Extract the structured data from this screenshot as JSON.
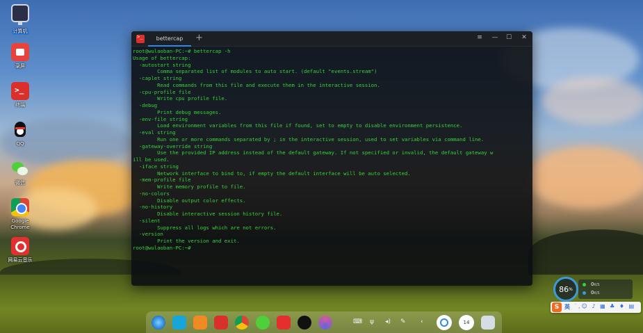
{
  "desktop": {
    "icons": [
      {
        "label": "计算机"
      },
      {
        "label": "录屏"
      },
      {
        "label": "终端"
      },
      {
        "label": "QQ"
      },
      {
        "label": "微信"
      },
      {
        "label": "Google Chrome"
      },
      {
        "label": "网易云音乐"
      }
    ]
  },
  "terminal": {
    "tab_title": "bettercap",
    "new_tab_glyph": "+",
    "menu_glyph": "≡",
    "minimize_glyph": "—",
    "maximize_glyph": "☐",
    "close_glyph": "✕",
    "lines": [
      "root@wulaoban-PC:~# bettercap -h",
      "Usage of bettercap:",
      "  -autostart string",
      "        Comma separated list of modules to auto start. (default \"events.stream\")",
      "  -caplet string",
      "        Read commands from this file and execute them in the interactive session.",
      "  -cpu-profile file",
      "        Write cpu profile file.",
      "  -debug",
      "        Print debug messages.",
      "  -env-file string",
      "        Load environment variables from this file if found, set to empty to disable environment persistence.",
      "  -eval string",
      "        Run one or more commands separated by ; in the interactive session, used to set variables via command line.",
      "  -gateway-override string",
      "        Use the provided IP address instead of the default gateway. If not specified or invalid, the default gateway w",
      "ill be used.",
      "  -iface string",
      "        Network interface to bind to, if empty the default interface will be auto selected.",
      "  -mem-profile file",
      "        Write memory profile to file.",
      "  -no-colors",
      "        Disable output color effects.",
      "  -no-history",
      "        Disable interactive session history file.",
      "  -silent",
      "        Suppress all logs which are not errors.",
      "  -version",
      "        Print the version and exit.",
      "root@wulaoban-PC:~#"
    ]
  },
  "dock": {
    "tray_icons": [
      "⌨",
      "ψ",
      "◂)",
      "✎",
      "‹"
    ],
    "clock_label": "14"
  },
  "speed_widget": {
    "percent": "86",
    "percent_unit": "%",
    "upload": "0",
    "upload_unit": "K/S",
    "download": "0",
    "download_unit": "K/S"
  },
  "ime": {
    "logo": "S",
    "lang": "英",
    "tools": "˙,☺ ♪ ▦ ♣ ♦ ▤"
  },
  "colors": {
    "terminal_text": "#36d33a",
    "tab_accent": "#2f87e8"
  }
}
